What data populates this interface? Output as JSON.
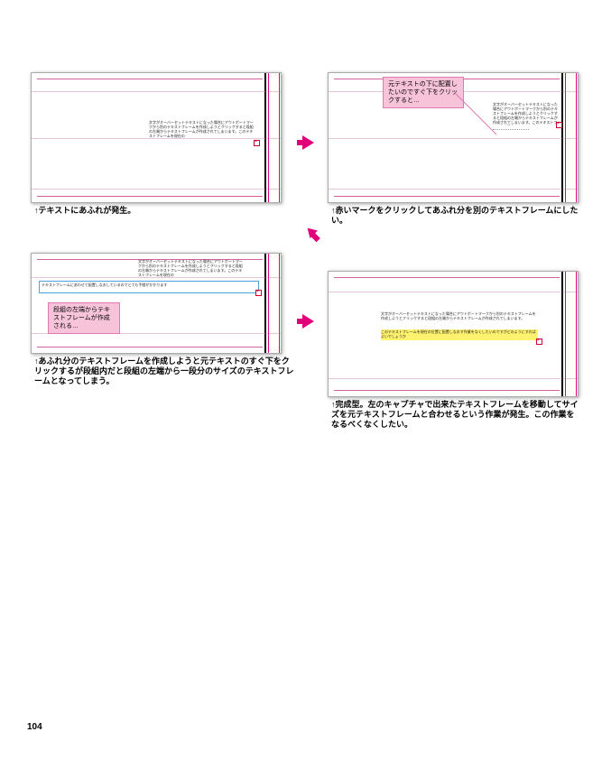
{
  "page_number": "104",
  "arrows": {
    "color": "#e2007a"
  },
  "panel1": {
    "caption": "↑テキストにあふれが発生。",
    "body_lorem": "文字がオーバーセットテキストになった場合にアウトポートマークから別のテキストフレームを作成しようとクリックすると段組の左端からテキストフレームが作成されてしまいます。このテキストフレームを現在の"
  },
  "panel2": {
    "caption": "↑赤いマークをクリックしてあふれ分を別のテキストフレームにしたい。",
    "callout": "元テキストの下に配置したいのですぐ下をクリックすると…",
    "body_lorem": "文字がオーバーセットテキストになった場合にアウトポートマークから別のテキストフレームを作成しようとクリックすると段組の左端からテキストフレームが作成されてしまいます。このテキストフレームを現在の"
  },
  "panel3": {
    "caption": "↑あふれ分のテキストフレームを作成しようと元テキストのすぐ下をクリックするが段組内だと段組の左端から一段分のサイズのテキストフレームとなってしまう。",
    "callout": "段組の左端からテキストフレームが作成される…",
    "body_top": "文字がオーバーセットテキストになった場合にアウトポートマークから別のテキストフレームを作成しようとクリックすると段組の左端からテキストフレームが作成されてしまいます。このテキストフレームを現在の",
    "newframe_lorem": "テキストフレームにあわせて配置しなおしているのでとても手間がかかります"
  },
  "panel4": {
    "caption": "↑完成型。左のキャプチャで出来たテキストフレームを移動してサイズを元テキストフレームと合わせるという作業が発生。この作業をなるべくなくしたい。",
    "body_lorem": "文字がオーバーセットテキストになった場合にアウトポートマークから別のテキストフレームを作成しようとクリックすると段組の左端からテキストフレームが作成されてしまいます。",
    "body_highlight": "このテキストフレームを現在の位置に配置しなおす作業をなくしたいのですがどのようにすればよいでしょうか"
  }
}
